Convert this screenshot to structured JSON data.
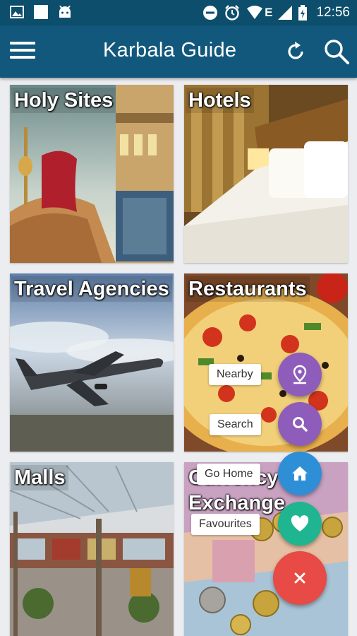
{
  "status_bar": {
    "time": "12:56",
    "left_icons": [
      "image-icon",
      "square-icon",
      "android-icon"
    ],
    "right_icons": [
      "do-not-disturb-icon",
      "alarm-icon",
      "wifi-icon",
      "network-e-icon",
      "signal-icon",
      "battery-icon"
    ],
    "network_letter": "E"
  },
  "app_bar": {
    "title": "Karbala Guide",
    "color": "#12587c"
  },
  "tiles": [
    {
      "label": "Holy Sites"
    },
    {
      "label": "Hotels"
    },
    {
      "label": "Travel Agencies"
    },
    {
      "label": "Restaurants"
    },
    {
      "label": "Malls"
    },
    {
      "label_line1": "Currency",
      "label_line2": "Exchange"
    }
  ],
  "fab_menu": {
    "items": [
      {
        "label": "Nearby",
        "icon": "location-pin-icon",
        "color": "#8e5cba"
      },
      {
        "label": "Search",
        "icon": "search-icon",
        "color": "#8e5cba"
      },
      {
        "label": "Go Home",
        "icon": "home-icon",
        "color": "#2f8fd6"
      },
      {
        "label": "Favourites",
        "icon": "heart-icon",
        "color": "#1fb590"
      }
    ],
    "close_icon": "close-icon",
    "close_color": "#e84a45"
  }
}
